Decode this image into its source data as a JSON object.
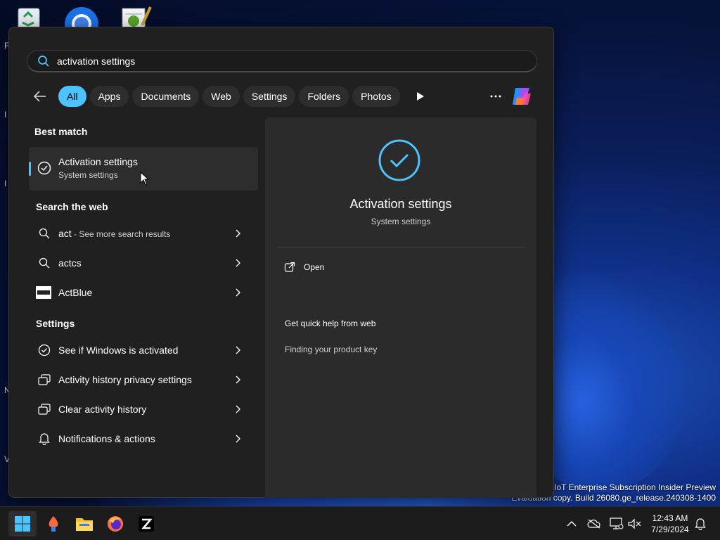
{
  "desktop": {
    "icons": [
      "recycle-bin-icon",
      "chrome-icon",
      "notepad-icon"
    ],
    "edge_letters": [
      "F",
      "I",
      "I",
      "N",
      "V"
    ],
    "watermark_line1": "1 IoT Enterprise Subscription Insider Preview",
    "watermark_line2": "Evaluation copy. Build 26080.ge_release.240308-1400"
  },
  "search": {
    "query": "activation settings"
  },
  "filters": {
    "back_icon": "arrow-left-icon",
    "chips": [
      {
        "label": "All",
        "active": true
      },
      {
        "label": "Apps",
        "active": false
      },
      {
        "label": "Documents",
        "active": false
      },
      {
        "label": "Web",
        "active": false
      },
      {
        "label": "Settings",
        "active": false
      },
      {
        "label": "Folders",
        "active": false
      },
      {
        "label": "Photos",
        "active": false
      }
    ],
    "more_label": "···"
  },
  "best_match": {
    "section_title": "Best match",
    "title": "Activation settings",
    "subtitle": "System settings"
  },
  "web": {
    "section_title": "Search the web",
    "items": [
      {
        "label": "act",
        "suffix": " - See more search results",
        "icon": "search-icon"
      },
      {
        "label": "actcs",
        "suffix": "",
        "icon": "search-icon"
      },
      {
        "label": "ActBlue",
        "suffix": "",
        "icon": "actblue-logo"
      }
    ]
  },
  "settings": {
    "section_title": "Settings",
    "items": [
      {
        "label": "See if Windows is activated",
        "icon": "check-circle-icon"
      },
      {
        "label": "Activity history privacy settings",
        "icon": "activity-history-icon"
      },
      {
        "label": "Clear activity history",
        "icon": "activity-history-icon"
      },
      {
        "label": "Notifications & actions",
        "icon": "bell-icon"
      }
    ]
  },
  "preview": {
    "title": "Activation settings",
    "subtitle": "System settings",
    "open_label": "Open",
    "help_label": "Get quick help from web",
    "link_label": "Finding your product key"
  },
  "taskbar": {
    "time": "12:43 AM",
    "date": "7/29/2024"
  },
  "colors": {
    "accent": "#4cc2ff",
    "panel": "#202020",
    "pane": "#2b2b2b"
  }
}
